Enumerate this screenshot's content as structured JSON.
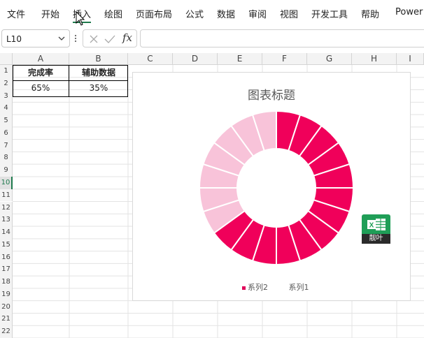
{
  "menu": {
    "items": [
      "文件",
      "开始",
      "插入",
      "绘图",
      "页面布局",
      "公式",
      "数据",
      "审阅",
      "视图",
      "开发工具",
      "帮助",
      "Power"
    ],
    "active": "插入"
  },
  "formula_bar": {
    "name_box": "L10",
    "fx_label": "fx",
    "value": ""
  },
  "grid": {
    "columns": [
      "A",
      "B",
      "C",
      "D",
      "E",
      "F",
      "G",
      "H",
      "I"
    ],
    "rows": [
      "1",
      "2",
      "3",
      "4",
      "5",
      "6",
      "7",
      "8",
      "9",
      "10",
      "11",
      "12",
      "13",
      "14",
      "15",
      "16",
      "17",
      "18",
      "19",
      "20",
      "21",
      "22"
    ],
    "selected_row": "10",
    "selected_cell": "L10"
  },
  "table": {
    "headers": [
      "完成率",
      "辅助数据"
    ],
    "values": [
      "65%",
      "35%"
    ]
  },
  "chart_data": {
    "type": "pie",
    "subtype": "doughnut",
    "title": "图表标题",
    "series": [
      {
        "name": "系列2",
        "values": [
          0.65,
          0.35
        ],
        "colors": [
          "#f0005a",
          "#f8c3d9"
        ]
      },
      {
        "name": "系列1",
        "values": [],
        "colors": []
      }
    ],
    "segments": 20,
    "legend": {
      "position": "bottom",
      "entries": [
        {
          "label": "系列2",
          "color": "#e0005a"
        },
        {
          "label": "系列1",
          "color": ""
        }
      ]
    },
    "colors": {
      "primary": "#f0005a",
      "secondary": "#f8c3d9"
    }
  },
  "badge": {
    "label": "靓叶",
    "icon": "excel-icon",
    "color": "#1f9e57"
  }
}
